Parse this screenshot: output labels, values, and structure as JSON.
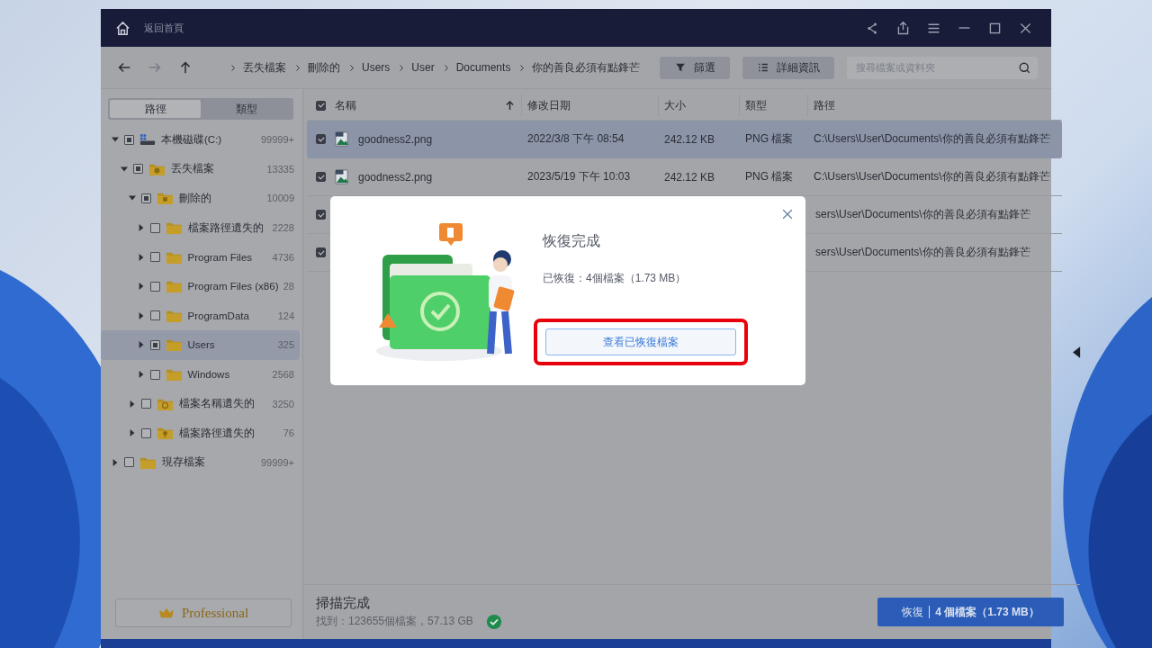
{
  "window": {
    "title": "返回首頁"
  },
  "nav_buttons": [
    {
      "kind": "back",
      "disabled": false
    },
    {
      "kind": "forward",
      "disabled": true
    },
    {
      "kind": "up",
      "disabled": false
    }
  ],
  "breadcrumbs": [
    "丟失檔案",
    "刪除的",
    "Users",
    "User",
    "Documents",
    "你的善良必須有點鋒芒"
  ],
  "toolbar_buttons": [
    {
      "kind": "filter",
      "label": "篩選"
    },
    {
      "kind": "details",
      "label": "詳細資訊"
    }
  ],
  "search": {
    "placeholder": "搜尋檔案或資料夾"
  },
  "sidebar": {
    "tabs": [
      {
        "label": "路徑",
        "selected": true
      },
      {
        "label": "類型",
        "selected": false
      }
    ],
    "tree": [
      {
        "kind": "drive",
        "label": "本機磁碟(C:)",
        "count": "99999+",
        "expanded": true,
        "checked": true,
        "selected": false,
        "children": [
          {
            "kind": "lost",
            "label": "丟失檔案",
            "count": "13335",
            "expanded": true,
            "checked": true,
            "selected": false,
            "children": [
              {
                "kind": "deleted",
                "label": "刪除的",
                "count": "10009",
                "expanded": true,
                "checked": true,
                "selected": false,
                "children": [
                  {
                    "kind": "folder",
                    "label": "檔案路徑遺失的",
                    "count": "2228",
                    "expanded": false,
                    "checked": false,
                    "selected": false
                  },
                  {
                    "kind": "folder",
                    "label": "Program Files",
                    "count": "4736",
                    "expanded": false,
                    "checked": false,
                    "selected": false
                  },
                  {
                    "kind": "folder",
                    "label": "Program Files (x86)",
                    "count": "28",
                    "expanded": false,
                    "checked": false,
                    "selected": false
                  },
                  {
                    "kind": "folder",
                    "label": "ProgramData",
                    "count": "124",
                    "expanded": false,
                    "checked": false,
                    "selected": false
                  },
                  {
                    "kind": "folder",
                    "label": "Users",
                    "count": "325",
                    "expanded": false,
                    "checked": true,
                    "selected": true
                  },
                  {
                    "kind": "folder",
                    "label": "Windows",
                    "count": "2568",
                    "expanded": false,
                    "checked": false,
                    "selected": false
                  }
                ]
              },
              {
                "kind": "noname",
                "label": "檔案名稱遺失的",
                "count": "3250",
                "expanded": false,
                "checked": false,
                "selected": false
              },
              {
                "kind": "nopath",
                "label": "檔案路徑遺失的",
                "count": "76",
                "expanded": false,
                "checked": false,
                "selected": false
              }
            ]
          }
        ]
      },
      {
        "kind": "folder",
        "label": "現存檔案",
        "count": "99999+",
        "expanded": false,
        "checked": false,
        "selected": false
      }
    ]
  },
  "upgrade_button": {
    "label": "Professional"
  },
  "table": {
    "all_checked": true,
    "columns": [
      {
        "label": "名稱",
        "sorted": true
      },
      {
        "label": "修改日期",
        "sorted": false
      },
      {
        "label": "大小",
        "sorted": false
      },
      {
        "label": "類型",
        "sorted": false
      },
      {
        "label": "路徑",
        "sorted": false
      }
    ],
    "rows": [
      {
        "selected": true,
        "checked": true,
        "name": "goodness2.png",
        "modified": "2022/3/8 下午 08:54",
        "size": "242.12 KB",
        "type": "PNG 檔案",
        "path": "C:\\Users\\User\\Documents\\你的善良必須有點鋒芒"
      },
      {
        "selected": false,
        "checked": true,
        "name": "goodness2.png",
        "modified": "2023/5/19 下午 10:03",
        "size": "242.12 KB",
        "type": "PNG 檔案",
        "path": "C:\\Users\\User\\Documents\\你的善良必須有點鋒芒"
      },
      {
        "selected": false,
        "checked": true,
        "path": "sers\\User\\Documents\\你的善良必須有點鋒芒"
      },
      {
        "selected": false,
        "checked": true,
        "path": "sers\\User\\Documents\\你的善良必須有點鋒芒"
      }
    ]
  },
  "status": {
    "title": "掃描完成",
    "summary": "找到：123655個檔案，57.13 GB",
    "complete": true
  },
  "recover_button": {
    "label": "恢復",
    "detail": "4 個檔案（1.73 MB）"
  },
  "dialog": {
    "title": "恢復完成",
    "message": "已恢復：4個檔案（1.73 MB）",
    "button": "查看已恢復檔案",
    "highlighted": true
  }
}
